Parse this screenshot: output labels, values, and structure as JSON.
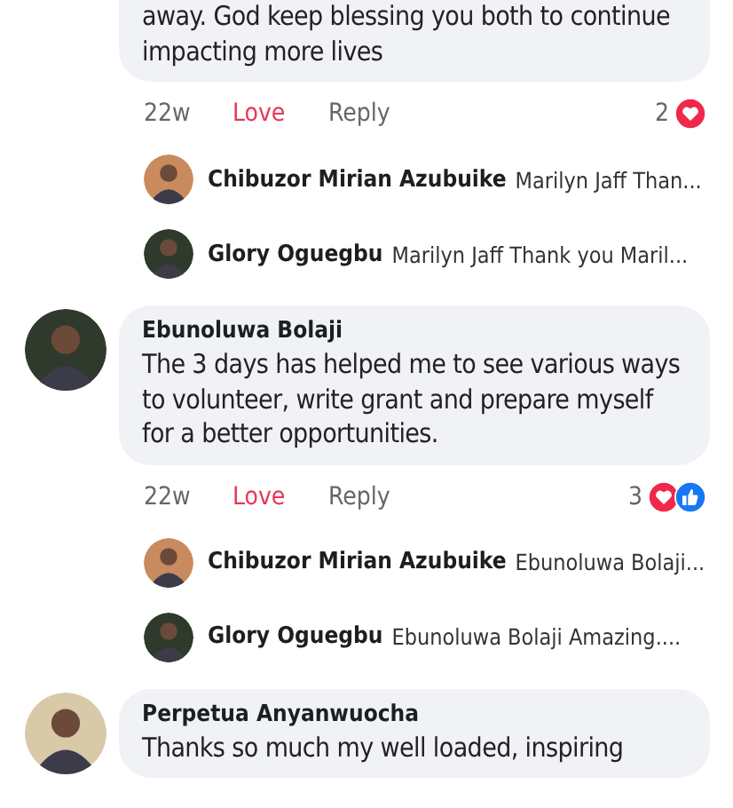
{
  "comments": [
    {
      "text": "away. God keep blessing you both to continue impacting more lives",
      "time": "22w",
      "reaction_label": "Love",
      "loved": true,
      "reply_label": "Reply",
      "reaction_count": "2",
      "reactions": [
        {
          "kind": "love"
        }
      ],
      "replies": [
        {
          "author": "Chibuzor Mirian Azubuike",
          "snippet": "Marilyn Jaff Than..."
        },
        {
          "author": "Glory Oguegbu",
          "snippet": "Marilyn Jaff Thank you Maril..."
        }
      ]
    },
    {
      "author": "Ebunoluwa Bolaji",
      "text": "The 3 days has helped me to see various ways to volunteer, write grant and prepare myself for a better opportunities.",
      "time": "22w",
      "reaction_label": "Love",
      "loved": true,
      "reply_label": "Reply",
      "reaction_count": "3",
      "reactions": [
        {
          "kind": "love"
        },
        {
          "kind": "like"
        }
      ],
      "replies": [
        {
          "author": "Chibuzor Mirian Azubuike",
          "snippet": "Ebunoluwa Bolaji..."
        },
        {
          "author": "Glory Oguegbu",
          "snippet": "Ebunoluwa Bolaji Amazing...."
        }
      ]
    },
    {
      "author": "Perpetua Anyanwuocha",
      "text": "Thanks so much my well loaded, inspiring"
    }
  ]
}
